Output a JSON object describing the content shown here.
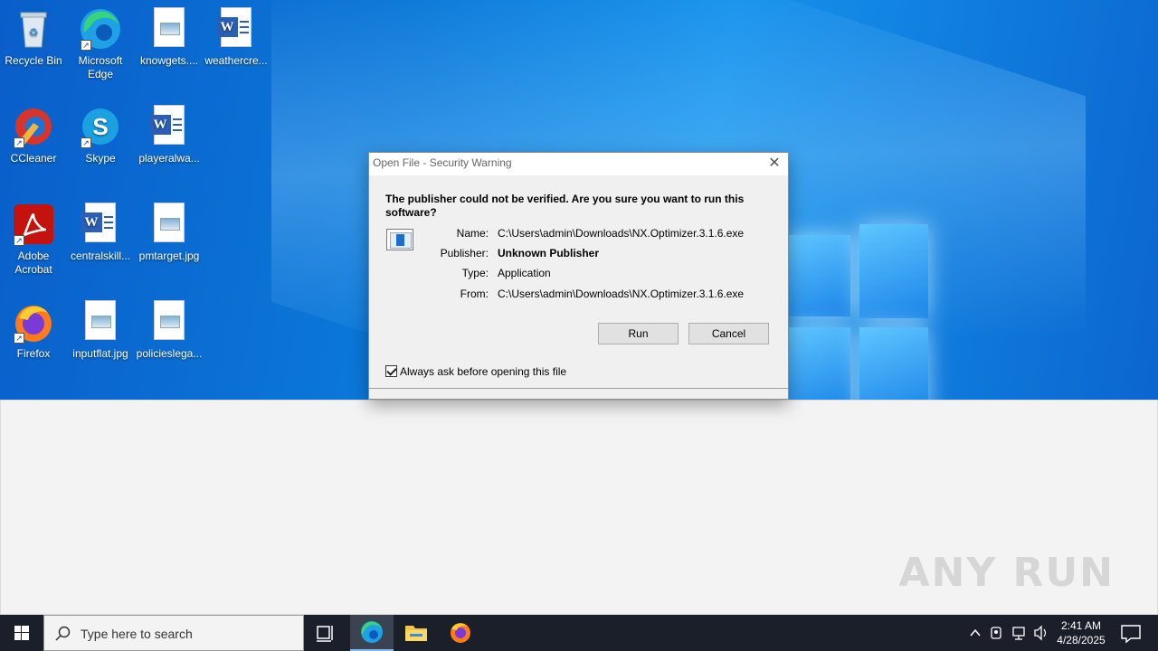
{
  "desktop": {
    "icons": [
      {
        "label": "Recycle Bin"
      },
      {
        "label": "Microsoft Edge"
      },
      {
        "label": "knowgets...."
      },
      {
        "label": "weathercre..."
      },
      {
        "label": "CCleaner"
      },
      {
        "label": "Skype"
      },
      {
        "label": "playeralwa..."
      },
      {
        "label": "Adobe Acrobat"
      },
      {
        "label": "centralskill..."
      },
      {
        "label": "pmtarget.jpg"
      },
      {
        "label": "Firefox"
      },
      {
        "label": "inputflat.jpg"
      },
      {
        "label": "policieslega..."
      }
    ]
  },
  "dialog": {
    "title": "Open File - Security Warning",
    "headline": "The publisher could not be verified.  Are you sure you want to run this software?",
    "fields": {
      "name_label": "Name:",
      "name_value": "C:\\Users\\admin\\Downloads\\NX.Optimizer.3.1.6.exe",
      "publisher_label": "Publisher:",
      "publisher_value": "Unknown Publisher",
      "type_label": "Type:",
      "type_value": "Application",
      "from_label": "From:",
      "from_value": "C:\\Users\\admin\\Downloads\\NX.Optimizer.3.1.6.exe"
    },
    "run_label": "Run",
    "cancel_label": "Cancel",
    "checkbox_label": "Always ask before opening this file",
    "checkbox_checked": true
  },
  "watermark": "ANY RUN",
  "taskbar": {
    "search_placeholder": "Type here to search",
    "time": "2:41 AM",
    "date": "4/28/2025"
  }
}
